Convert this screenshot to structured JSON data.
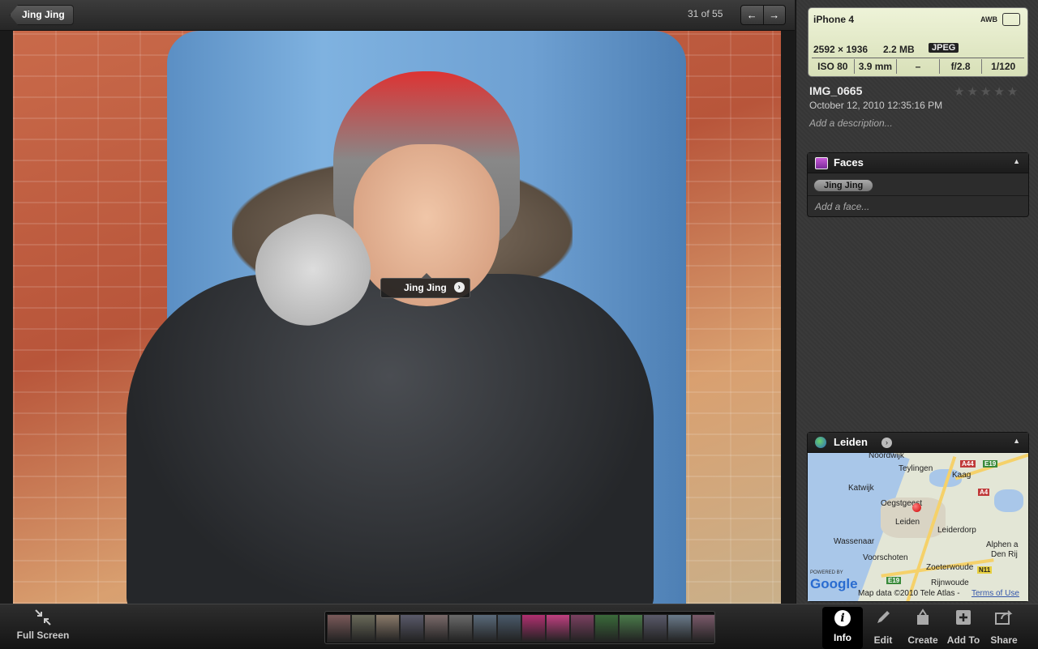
{
  "topbar": {
    "back_label": "Jing Jing",
    "counter": "31 of 55",
    "prev_icon": "←",
    "next_icon": "→"
  },
  "photo": {
    "face_tag": "Jing Jing",
    "face_tag_arrow": "›"
  },
  "exif": {
    "model": "iPhone 4",
    "white_balance": "AWB",
    "dimensions": "2592 × 1936",
    "size": "2.2 MB",
    "format": "JPEG",
    "iso": "ISO 80",
    "focal": "3.9 mm",
    "exposure_bias": "–",
    "aperture": "f/2.8",
    "shutter": "1/120"
  },
  "details": {
    "filename": "IMG_0665",
    "rating_stars": "★★★★★",
    "rating": 0,
    "date": "October 12, 2010 12:35:16 PM",
    "description_placeholder": "Add a description..."
  },
  "faces": {
    "title": "Faces",
    "collapse": "▲",
    "chips": [
      "Jing Jing"
    ],
    "add_placeholder": "Add a face..."
  },
  "location": {
    "title": "Leiden",
    "collapse": "▲",
    "arrow": "›",
    "map": {
      "places": [
        "Noordwijk",
        "Teylingen",
        "Kaag",
        "Katwijk",
        "Oegstgeest",
        "Leiden",
        "Leiderdorp",
        "Wassenaar",
        "Voorschoten",
        "Zoeterwoude",
        "Rijnwoude",
        "Alphen a",
        "Den Rij"
      ],
      "shields": [
        "A44",
        "E19",
        "A4",
        "N11",
        "E19"
      ],
      "powered_by": "POWERED BY",
      "brand": "Google",
      "attribution": "Map data ©2010 Tele Atlas -",
      "terms": "Terms of Use"
    }
  },
  "toolbar": {
    "fullscreen": "Full Screen",
    "info": "Info",
    "info_icon": "i",
    "edit": "Edit",
    "create": "Create",
    "add_to": "Add To",
    "share": "Share"
  },
  "filmstrip": {
    "selected_index": 16,
    "colors": [
      "#7a5a5a",
      "#6a6a5a",
      "#8a7a6a",
      "#5a5a6a",
      "#7a6a6a",
      "#6a6a6a",
      "#5a6a7a",
      "#4a5a6a",
      "#b03070",
      "#c04080",
      "#7a4060",
      "#3a6a3a",
      "#4a7a4a",
      "#5a5a6a",
      "#6a7a8a",
      "#7a5a6a",
      "#8a6a4a",
      "#5a5a5a"
    ]
  }
}
